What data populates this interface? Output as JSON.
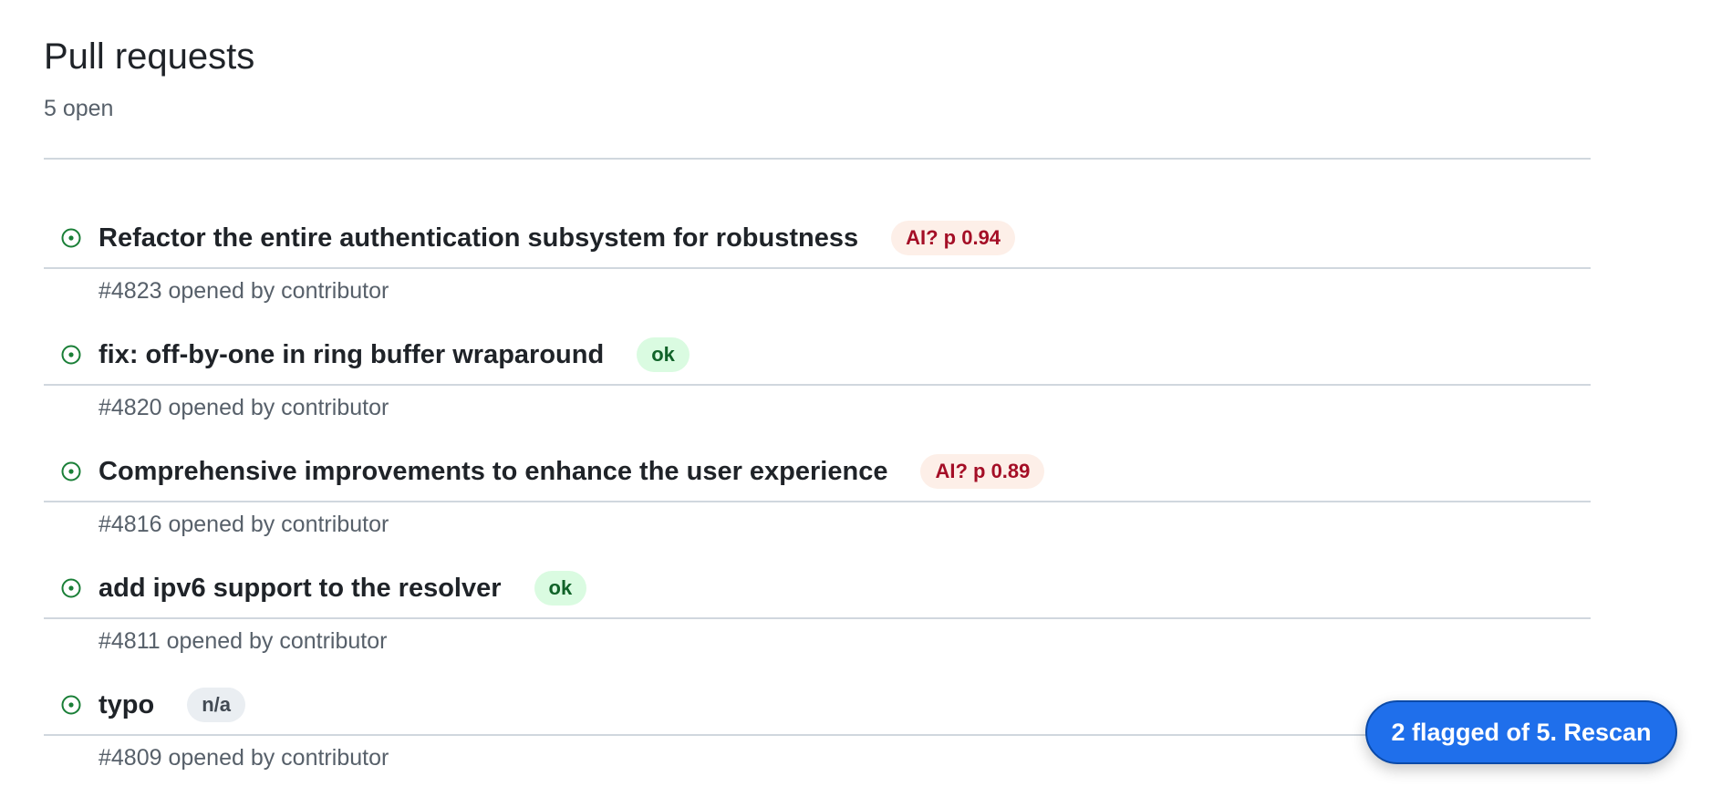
{
  "header": {
    "title": "Pull requests",
    "count": "5 open"
  },
  "pull_requests": [
    {
      "title": "Refactor the entire authentication subsystem for robustness",
      "badge": "AI? p 0.94",
      "badge_kind": "flagged",
      "meta": "#4823 opened by contributor",
      "icon": "pr-open-icon"
    },
    {
      "title": "fix: off-by-one in ring buffer wraparound",
      "badge": "ok",
      "badge_kind": "ok",
      "meta": "#4820 opened by contributor",
      "icon": "pr-open-icon"
    },
    {
      "title": "Comprehensive improvements to enhance the user experience",
      "badge": "AI? p 0.89",
      "badge_kind": "flagged",
      "meta": "#4816 opened by contributor",
      "icon": "pr-open-icon"
    },
    {
      "title": "add ipv6 support to the resolver",
      "badge": "ok",
      "badge_kind": "ok",
      "meta": "#4811 opened by contributor",
      "icon": "pr-open-icon"
    },
    {
      "title": "typo",
      "badge": "n/a",
      "badge_kind": "na",
      "meta": "#4809 opened by contributor",
      "icon": "pr-open-icon"
    }
  ],
  "rescan_button": {
    "label": "2 flagged of 5. Rescan"
  },
  "colors": {
    "open_icon": "#1a7f37",
    "flagged_bg": "#fdefe8",
    "flagged_text": "#a40e26",
    "ok_bg": "#dafbe1",
    "ok_text": "#116329",
    "na_bg": "#eaeef2",
    "na_text": "#424a53",
    "accent": "#1f6feb"
  }
}
